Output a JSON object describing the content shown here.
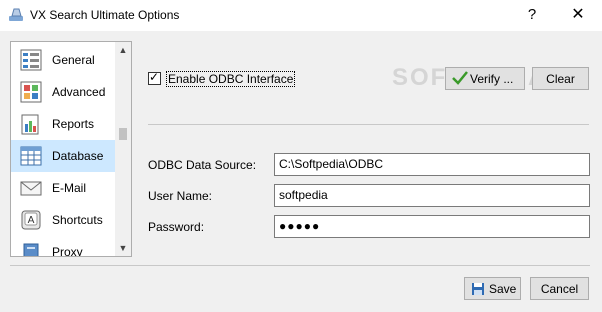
{
  "window": {
    "title": "VX Search Ultimate Options",
    "help_glyph": "?",
    "close_glyph": "✕"
  },
  "sidebar": {
    "items": [
      {
        "label": "General",
        "icon": "general-icon"
      },
      {
        "label": "Advanced",
        "icon": "advanced-icon"
      },
      {
        "label": "Reports",
        "icon": "reports-icon"
      },
      {
        "label": "Database",
        "icon": "database-icon",
        "selected": true
      },
      {
        "label": "E-Mail",
        "icon": "email-icon"
      },
      {
        "label": "Shortcuts",
        "icon": "shortcuts-icon"
      },
      {
        "label": "Proxy",
        "icon": "proxy-icon"
      }
    ],
    "scroll_up": "▲",
    "scroll_down": "▼"
  },
  "odbc": {
    "enable_label": "Enable ODBC Interface",
    "enabled": true,
    "check_glyph": "✓",
    "verify_label": "Verify ...",
    "clear_label": "Clear"
  },
  "watermark": "SOFTPEDIA",
  "fields": {
    "data_source_label": "ODBC Data Source:",
    "data_source_value": "C:\\Softpedia\\ODBC",
    "user_name_label": "User Name:",
    "user_name_value": "softpedia",
    "password_label": "Password:",
    "password_value": "●●●●●"
  },
  "footer": {
    "save_label": "Save",
    "cancel_label": "Cancel"
  },
  "colors": {
    "selected_bg": "#cde8ff",
    "verify_check": "#3a9a2a",
    "save_icon": "#2f6bb3"
  }
}
